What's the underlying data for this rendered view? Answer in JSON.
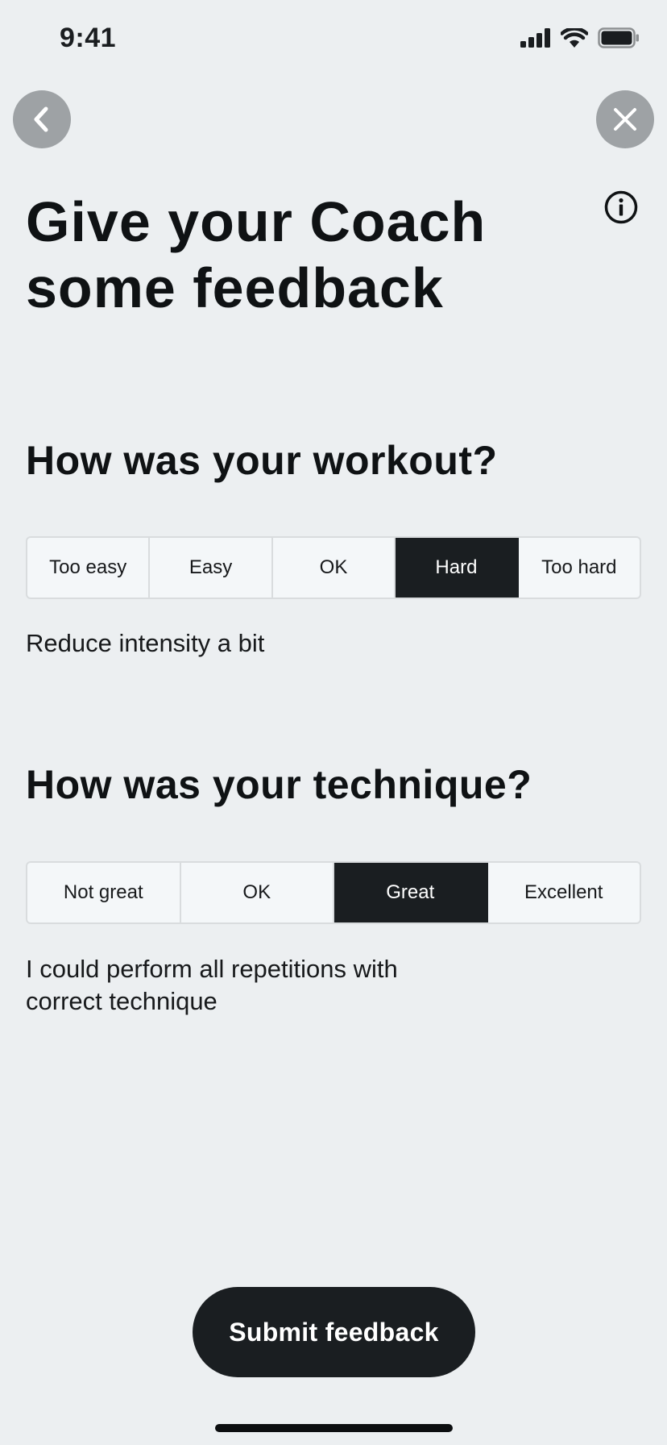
{
  "status_bar": {
    "time": "9:41",
    "icons": [
      "signal-icon",
      "wifi-icon",
      "battery-icon"
    ]
  },
  "header": {
    "back_icon": "chevron-left-icon",
    "close_icon": "close-icon",
    "info_icon": "info-icon",
    "title": "Give your Coach some feedback"
  },
  "workout": {
    "question": "How was your workout?",
    "options": [
      "Too easy",
      "Easy",
      "OK",
      "Hard",
      "Too hard"
    ],
    "selected": "Hard",
    "description": "Reduce intensity a bit"
  },
  "technique": {
    "question": "How was your technique?",
    "options": [
      "Not great",
      "OK",
      "Great",
      "Excellent"
    ],
    "selected": "Great",
    "description": "I could perform all repetitions with correct technique"
  },
  "footer": {
    "submit_label": "Submit feedback"
  },
  "colors": {
    "background": "#eceff1",
    "selected_segment": "#1a1e21",
    "round_button": "#9ea2a5"
  }
}
